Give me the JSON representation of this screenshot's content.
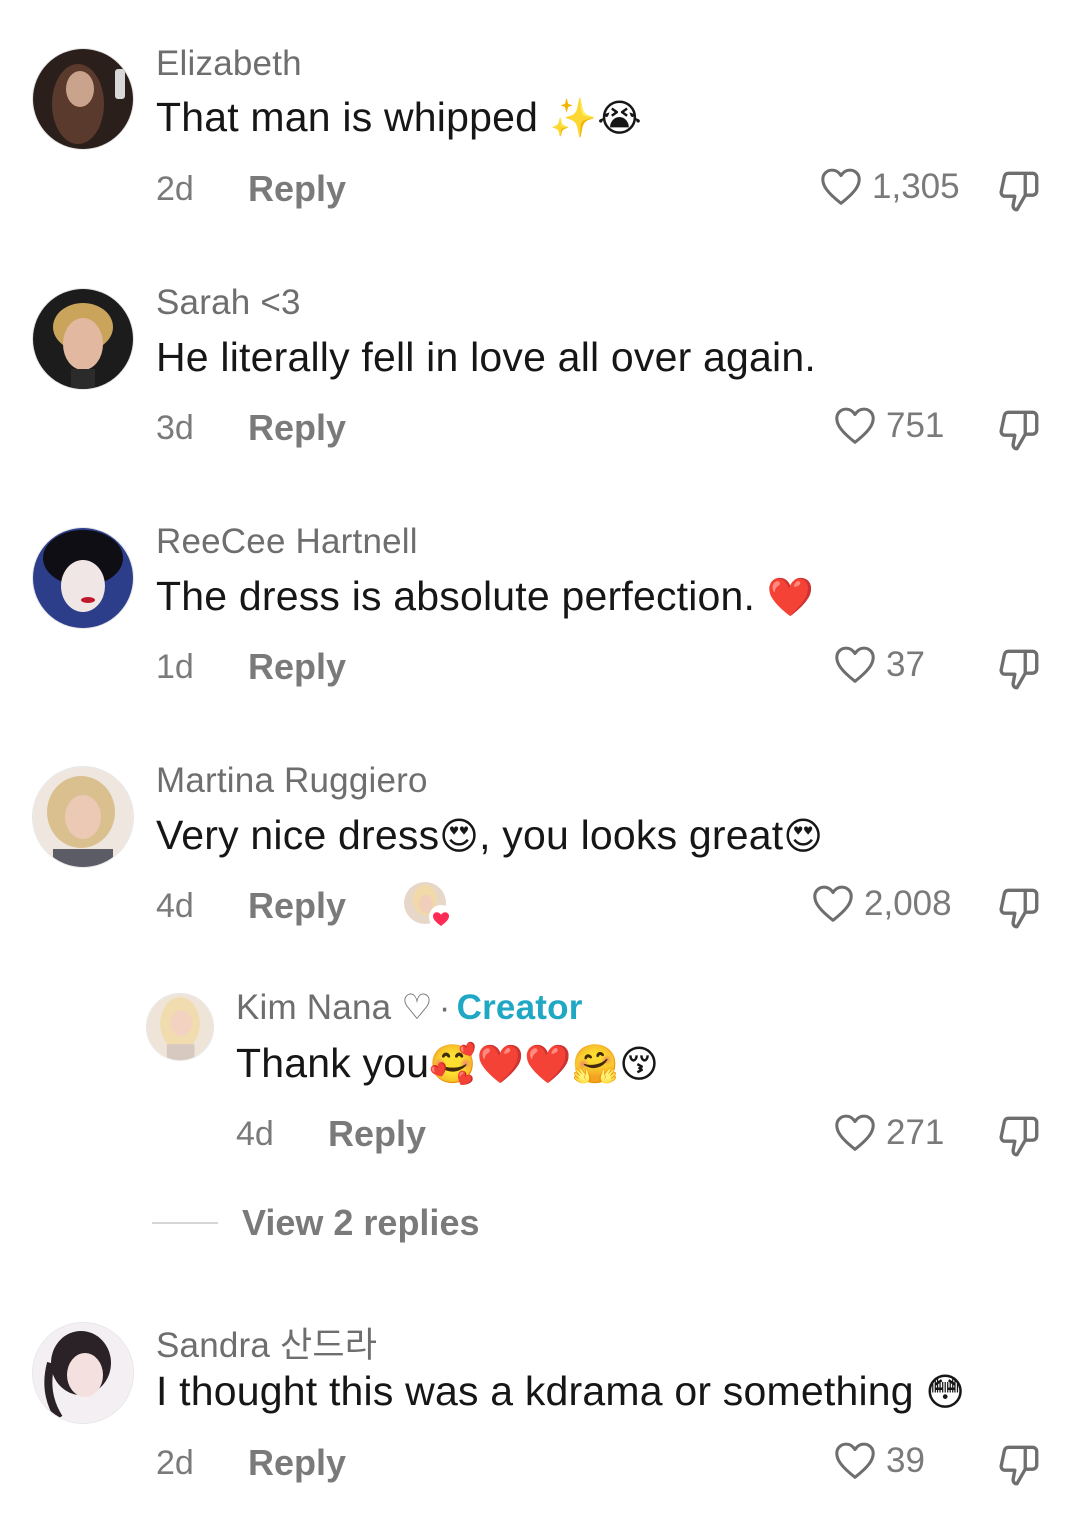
{
  "comments": [
    {
      "username": "Elizabeth",
      "text": "That man is whipped ",
      "emoji": "✨😭",
      "time": "2d",
      "reply_label": "Reply",
      "likes": "1,305"
    },
    {
      "username": "Sarah <3",
      "text": "He literally fell in love all over again.",
      "emoji": "",
      "time": "3d",
      "reply_label": "Reply",
      "likes": "751"
    },
    {
      "username": "ReeCee Hartnell",
      "text": "The dress is absolute perfection. ",
      "emoji": "❤️",
      "time": "1d",
      "reply_label": "Reply",
      "likes": "37"
    },
    {
      "username": "Martina Ruggiero",
      "text_part1": "Very nice dress",
      "emoji1": "😍",
      "text_part2": ", you looks great",
      "emoji2": "😍",
      "time": "4d",
      "reply_label": "Reply",
      "likes": "2,008"
    }
  ],
  "creator_reply": {
    "username": "Kim Nana ♡",
    "separator": "·",
    "creator_label": "Creator",
    "text": "Thank you",
    "emoji": "🥰❤️❤️🤗😚",
    "time": "4d",
    "reply_label": "Reply",
    "likes": "271"
  },
  "view_replies": "View 2 replies",
  "last_comment": {
    "username": "Sandra 산드라",
    "text": "I thought this was a kdrama or something ",
    "emoji": "😳",
    "time": "2d",
    "reply_label": "Reply",
    "likes": "39"
  },
  "icons": {
    "like": "heart-outline-icon",
    "dislike": "thumbs-down-outline-icon",
    "creator_liked": "creator-liked-heart-badge"
  },
  "colors": {
    "username": "#6e6e6e",
    "text": "#161616",
    "meta": "#7a7a7a",
    "creator": "#1fa7c4",
    "heart_badge": "#fe2c55"
  }
}
